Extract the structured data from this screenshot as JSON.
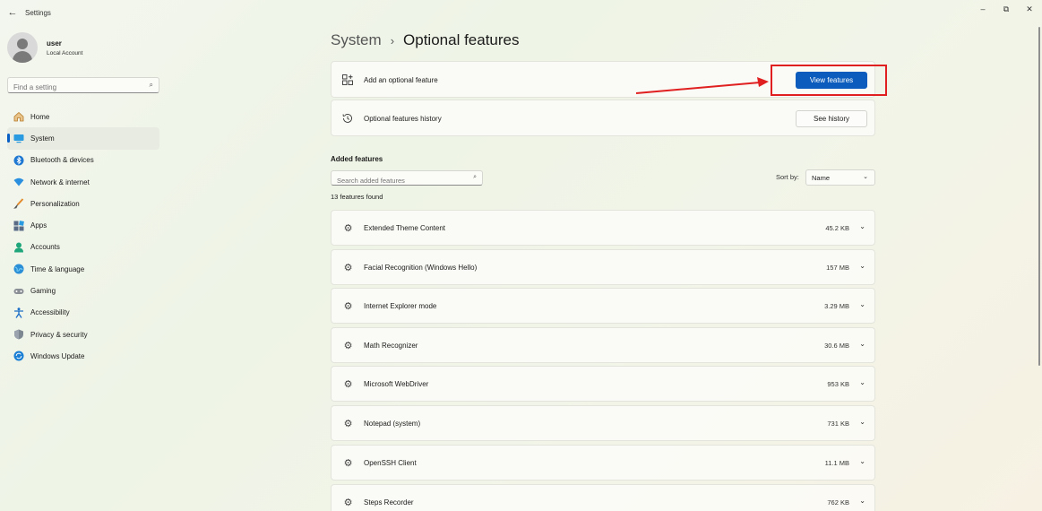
{
  "window": {
    "title": "Settings",
    "back_glyph": "←",
    "minimize_glyph": "–",
    "maximize_glyph": "⧉",
    "close_glyph": "✕"
  },
  "profile": {
    "name": "user",
    "account_type": "Local Account"
  },
  "sidebar": {
    "search_placeholder": "Find a setting",
    "items": [
      {
        "label": "Home",
        "icon": "home-icon",
        "active": false
      },
      {
        "label": "System",
        "icon": "system-icon",
        "active": true
      },
      {
        "label": "Bluetooth & devices",
        "icon": "bluetooth-icon",
        "active": false
      },
      {
        "label": "Network & internet",
        "icon": "network-icon",
        "active": false
      },
      {
        "label": "Personalization",
        "icon": "brush-icon",
        "active": false
      },
      {
        "label": "Apps",
        "icon": "apps-icon",
        "active": false
      },
      {
        "label": "Accounts",
        "icon": "accounts-icon",
        "active": false
      },
      {
        "label": "Time & language",
        "icon": "globe-icon",
        "active": false
      },
      {
        "label": "Gaming",
        "icon": "gamepad-icon",
        "active": false
      },
      {
        "label": "Accessibility",
        "icon": "accessibility-icon",
        "active": false
      },
      {
        "label": "Privacy & security",
        "icon": "shield-icon",
        "active": false
      },
      {
        "label": "Windows Update",
        "icon": "update-icon",
        "active": false
      }
    ]
  },
  "breadcrumb": {
    "parent": "System",
    "separator": "›",
    "current": "Optional features"
  },
  "add_feature": {
    "label": "Add an optional feature",
    "button": "View features"
  },
  "history": {
    "label": "Optional features history",
    "button": "See history"
  },
  "added": {
    "title": "Added features",
    "search_placeholder": "Search added features",
    "sort_label": "Sort by:",
    "sort_value": "Name",
    "count": "13 features found",
    "features": [
      {
        "name": "Extended Theme Content",
        "size": "45.2 KB"
      },
      {
        "name": "Facial Recognition (Windows Hello)",
        "size": "157 MB"
      },
      {
        "name": "Internet Explorer mode",
        "size": "3.29 MB"
      },
      {
        "name": "Math Recognizer",
        "size": "30.6 MB"
      },
      {
        "name": "Microsoft WebDriver",
        "size": "953 KB"
      },
      {
        "name": "Notepad (system)",
        "size": "731 KB"
      },
      {
        "name": "OpenSSH Client",
        "size": "11.1 MB"
      },
      {
        "name": "Steps Recorder",
        "size": "762 KB"
      }
    ]
  },
  "colors": {
    "accent": "#0b5cbc",
    "annotation": "#e02020"
  }
}
